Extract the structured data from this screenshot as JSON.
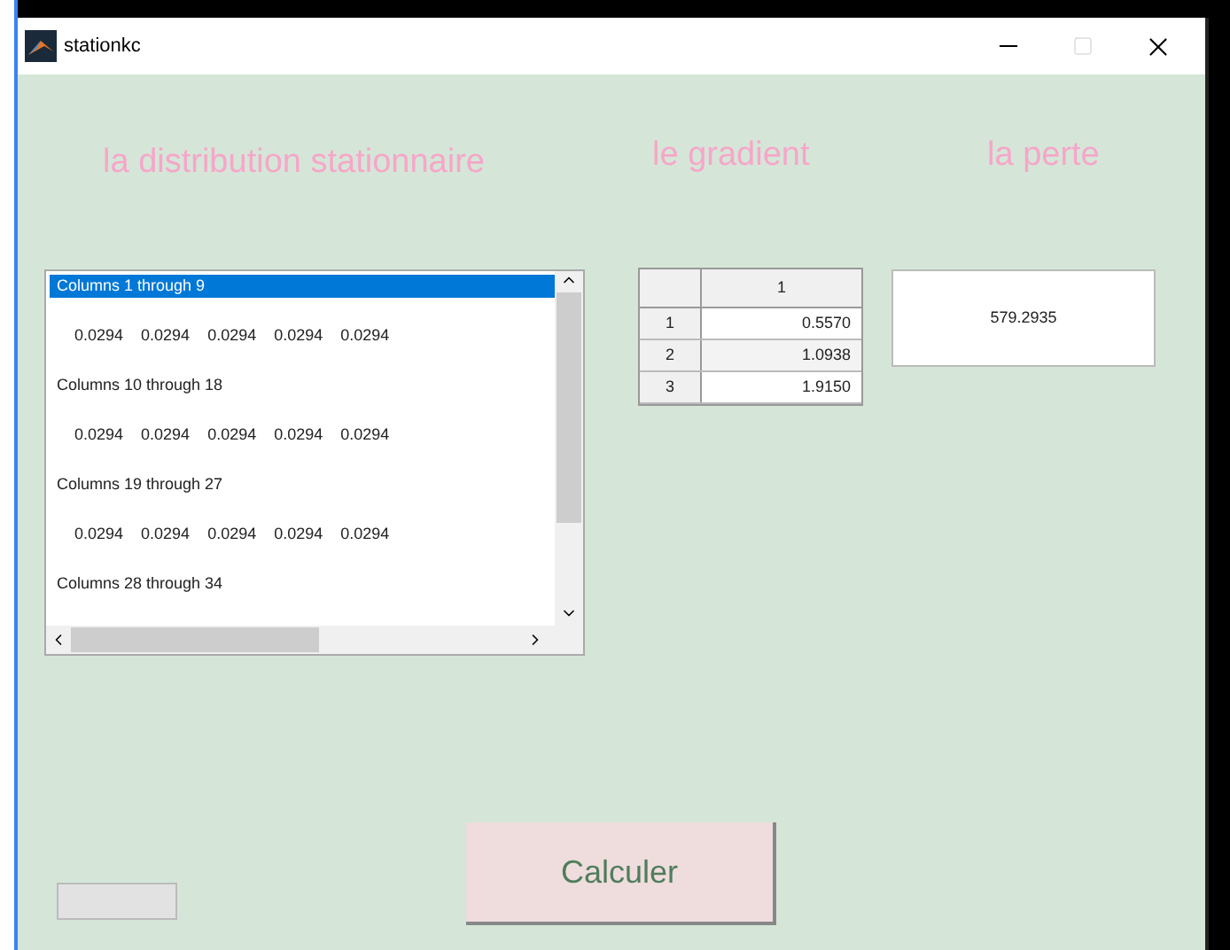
{
  "window": {
    "title": "stationkc"
  },
  "labels": [
    "la distribution stationnaire",
    "le gradient",
    "la perte"
  ],
  "listbox": {
    "rows": [
      {
        "kind": "header",
        "text": "Columns 1 through 9",
        "selected": true
      },
      {
        "kind": "values",
        "values": [
          "0.0294",
          "0.0294",
          "0.0294",
          "0.0294",
          "0.0294"
        ],
        "selected": false
      },
      {
        "kind": "header",
        "text": "Columns 10 through 18",
        "selected": false
      },
      {
        "kind": "values",
        "values": [
          "0.0294",
          "0.0294",
          "0.0294",
          "0.0294",
          "0.0294"
        ],
        "selected": false
      },
      {
        "kind": "header",
        "text": "Columns 19 through 27",
        "selected": false
      },
      {
        "kind": "values",
        "values": [
          "0.0294",
          "0.0294",
          "0.0294",
          "0.0294",
          "0.0294"
        ],
        "selected": false
      },
      {
        "kind": "header",
        "text": "Columns 28 through 34",
        "selected": false
      }
    ]
  },
  "gradient_table": {
    "columns": [
      "1"
    ],
    "rows": [
      {
        "index": "1",
        "value": "0.5570"
      },
      {
        "index": "2",
        "value": "1.0938"
      },
      {
        "index": "3",
        "value": "1.9150"
      }
    ]
  },
  "perte": {
    "value": "579.2935"
  },
  "button": {
    "label": "Calculer"
  }
}
